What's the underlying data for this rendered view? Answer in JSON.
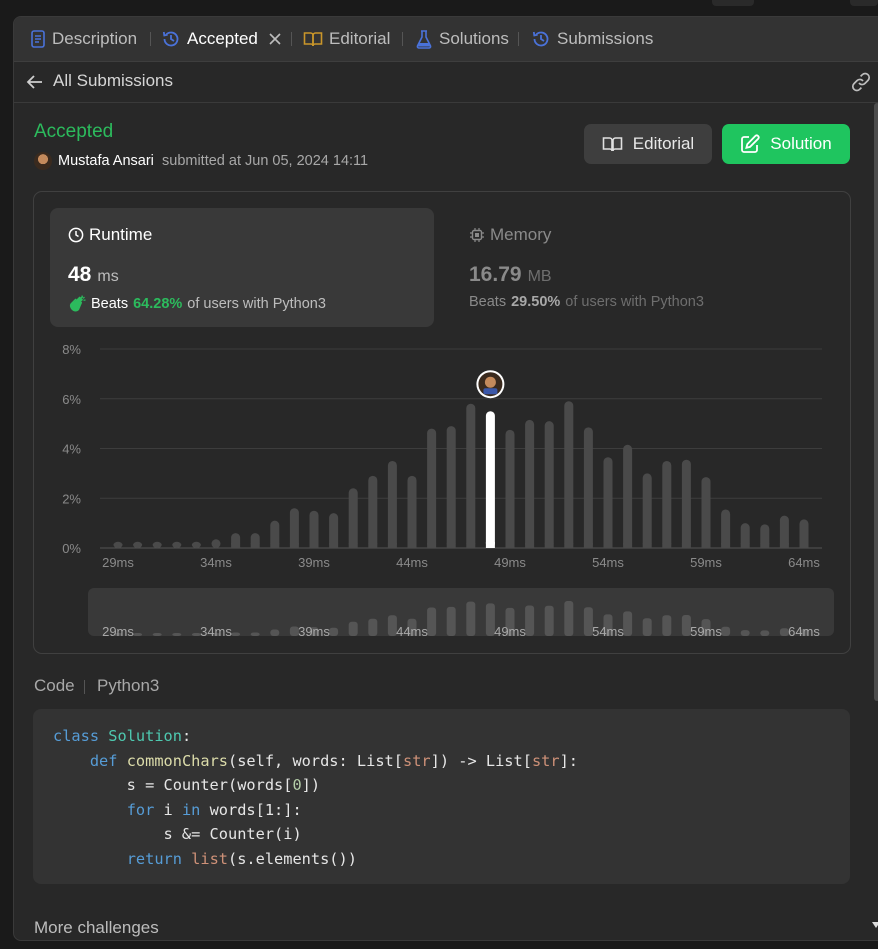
{
  "tabs": [
    {
      "label": "Description",
      "icon": "document-icon"
    },
    {
      "label": "Accepted",
      "icon": "history-icon",
      "active": true
    },
    {
      "label": "Editorial",
      "icon": "book-icon"
    },
    {
      "label": "Solutions",
      "icon": "flask-icon"
    },
    {
      "label": "Submissions",
      "icon": "history-icon"
    }
  ],
  "subbar": {
    "back_label": "All Submissions"
  },
  "submission": {
    "status": "Accepted",
    "author": "Mustafa Ansari",
    "submitted_text": "submitted at Jun 05, 2024 14:11"
  },
  "buttons": {
    "editorial": "Editorial",
    "solution": "Solution"
  },
  "runtime": {
    "title": "Runtime",
    "value": "48",
    "unit": "ms",
    "beats_prefix": "Beats",
    "beats_pct": "64.28%",
    "beats_suffix": "of users with Python3"
  },
  "memory": {
    "title": "Memory",
    "value": "16.79",
    "unit": "MB",
    "beats_prefix": "Beats",
    "beats_pct": "29.50%",
    "beats_suffix": "of users with Python3"
  },
  "chart_data": {
    "type": "bar",
    "title": "",
    "xlabel": "",
    "ylabel": "",
    "ylim": [
      0,
      8
    ],
    "y_ticks": [
      "0%",
      "2%",
      "4%",
      "6%",
      "8%"
    ],
    "x_ticks": [
      "29ms",
      "34ms",
      "39ms",
      "44ms",
      "49ms",
      "54ms",
      "59ms",
      "64ms"
    ],
    "x_start": 29,
    "x_end": 64,
    "values": [
      0.25,
      0.25,
      0.25,
      0.25,
      0.25,
      0.35,
      0.6,
      0.6,
      1.1,
      1.6,
      1.5,
      1.4,
      2.4,
      2.9,
      3.5,
      2.9,
      4.8,
      4.9,
      5.8,
      5.5,
      4.75,
      5.15,
      5.1,
      5.9,
      4.85,
      3.65,
      4.15,
      3.0,
      3.5,
      3.55,
      2.85,
      1.55,
      1.0,
      0.95,
      1.3,
      1.15
    ],
    "highlight_ms": 48,
    "colors": {
      "bar": "#4a4a4a",
      "highlight": "#ffffff",
      "grid": "#3d3d3d",
      "tick": "#8a8a8a"
    }
  },
  "code": {
    "label": "Code",
    "language": "Python3",
    "lines": [
      [
        {
          "t": "class ",
          "c": "kw"
        },
        {
          "t": "Solution",
          "c": "cls"
        },
        {
          "t": ":",
          "c": ""
        }
      ],
      [
        {
          "t": "    ",
          "c": ""
        },
        {
          "t": "def ",
          "c": "kw"
        },
        {
          "t": "commonChars",
          "c": "fn"
        },
        {
          "t": "(self, words: List[",
          "c": ""
        },
        {
          "t": "str",
          "c": "bi"
        },
        {
          "t": "]) -> List[",
          "c": ""
        },
        {
          "t": "str",
          "c": "bi"
        },
        {
          "t": "]:",
          "c": ""
        }
      ],
      [
        {
          "t": "        s = Counter(words[",
          "c": ""
        },
        {
          "t": "0",
          "c": "num"
        },
        {
          "t": "])",
          "c": ""
        }
      ],
      [
        {
          "t": "        ",
          "c": ""
        },
        {
          "t": "for ",
          "c": "kw"
        },
        {
          "t": "i ",
          "c": ""
        },
        {
          "t": "in ",
          "c": "kw"
        },
        {
          "t": "words[1:]:",
          "c": ""
        }
      ],
      [
        {
          "t": "            s &= Counter(i)",
          "c": ""
        }
      ],
      [
        {
          "t": "        ",
          "c": ""
        },
        {
          "t": "return ",
          "c": "kw"
        },
        {
          "t": "list",
          "c": "bi"
        },
        {
          "t": "(s.elements())",
          "c": ""
        }
      ]
    ]
  },
  "more": "More challenges"
}
